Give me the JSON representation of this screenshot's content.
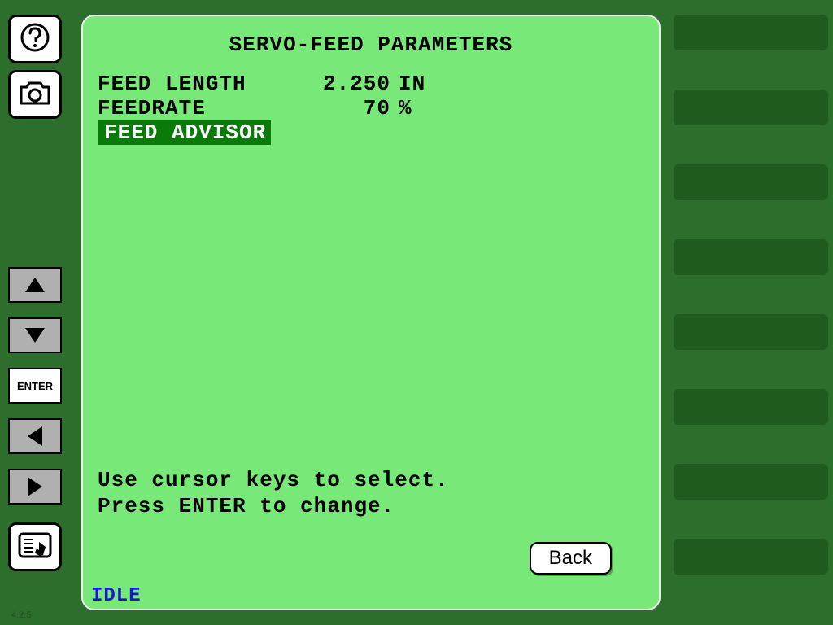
{
  "title": "SERVO-FEED PARAMETERS",
  "params": {
    "feed_length": {
      "label": "FEED LENGTH",
      "value": "2.250",
      "unit": "IN"
    },
    "feedrate": {
      "label": "FEEDRATE",
      "value": "70",
      "unit": "%"
    },
    "feed_advisor": {
      "label": "FEED ADVISOR"
    }
  },
  "hint": {
    "line1": "Use cursor keys to select.",
    "line2": "Press ENTER to change."
  },
  "back_label": "Back",
  "status": "IDLE",
  "enter_label": "ENTER",
  "version": "4.2.5"
}
